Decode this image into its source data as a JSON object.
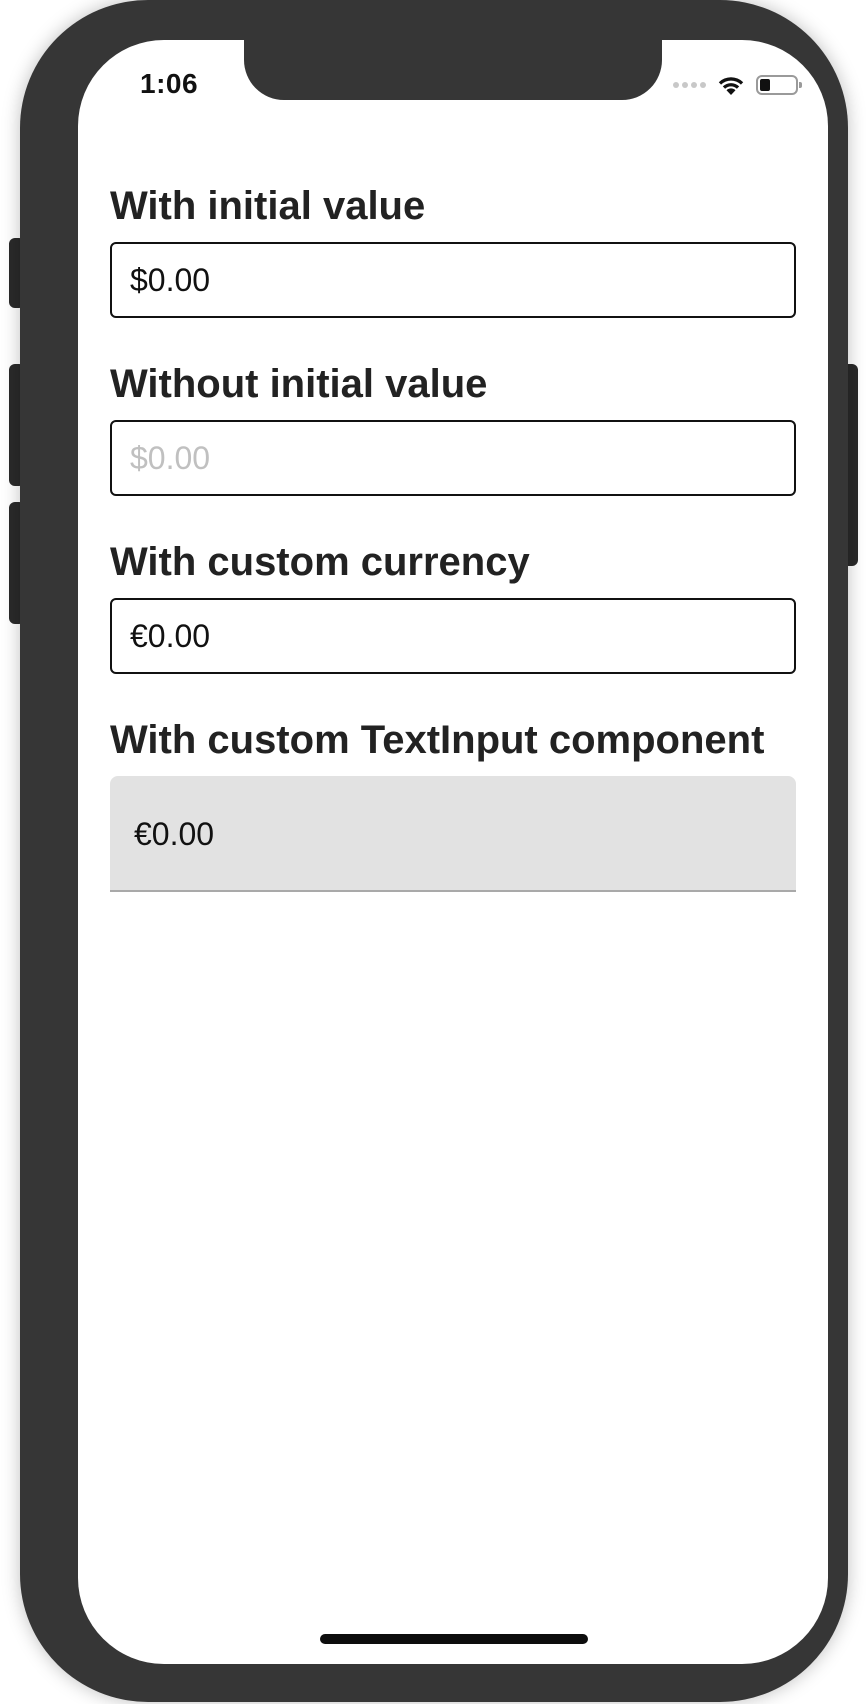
{
  "status_bar": {
    "time": "1:06",
    "battery_level": 0.3
  },
  "fields": [
    {
      "label": "With initial value",
      "value": "$0.00",
      "placeholder": ""
    },
    {
      "label": "Without initial value",
      "value": "",
      "placeholder": "$0.00"
    },
    {
      "label": "With custom currency",
      "value": "€0.00",
      "placeholder": ""
    },
    {
      "label": "With custom TextInput component",
      "value": "€0.00",
      "placeholder": ""
    }
  ],
  "icons": {
    "wifi": "wifi-icon",
    "battery": "battery-icon",
    "signal": "cellular-signal-icon"
  },
  "colors": {
    "frame": "#363636",
    "label_text": "#222222",
    "placeholder_text": "#c0c0c0",
    "custom_input_bg": "#e2e2e2",
    "custom_input_underline": "#a9a9a9"
  }
}
